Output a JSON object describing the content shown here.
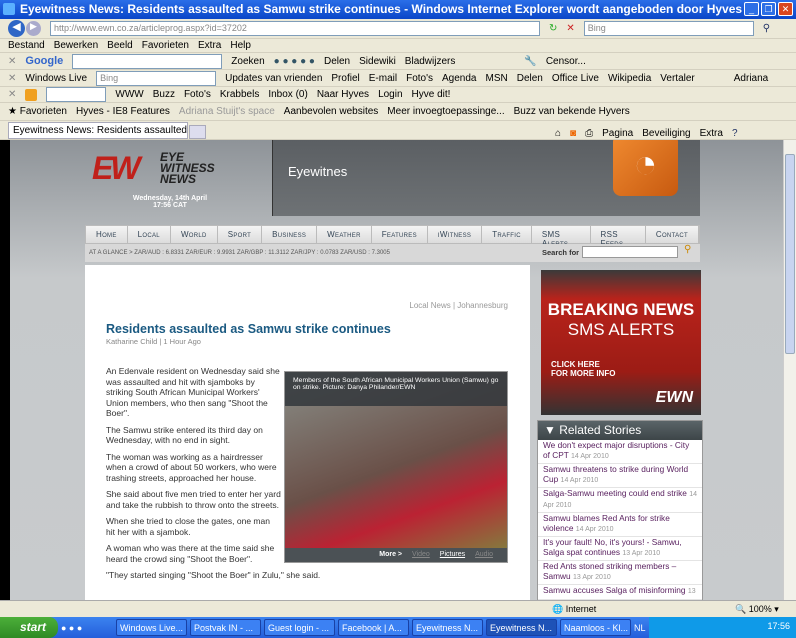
{
  "window": {
    "title": "Eyewitness News: Residents assaulted as Samwu strike continues - Windows Internet Explorer wordt aangeboden door Hyves"
  },
  "address": {
    "url": "http://www.ewn.co.za/articleprog.aspx?id=37202",
    "search_placeholder": "Bing"
  },
  "menu": [
    "Bestand",
    "Bewerken",
    "Beeld",
    "Favorieten",
    "Extra",
    "Help"
  ],
  "google_toolbar": {
    "logo": "Google",
    "search": "Zoeken",
    "share": "Delen",
    "sidewiki": "Sidewiki",
    "bookmarks": "Bladwijzers",
    "censor": "Censor..."
  },
  "live_toolbar": {
    "brand": "Windows Live",
    "search_placeholder": "Bing",
    "links": [
      "Updates van vrienden",
      "Profiel",
      "E-mail",
      "Foto's",
      "Agenda",
      "MSN",
      "Delen"
    ],
    "office": "Office Live",
    "wikipedia": "Wikipedia",
    "translate": "Vertaler",
    "user": "Adriana"
  },
  "hyves_toolbar": {
    "links": [
      "WWW",
      "Buzz",
      "Foto's",
      "Krabbels",
      "Inbox (0)",
      "Naar Hyves",
      "Login",
      "Hyve dit!"
    ]
  },
  "favorites_bar": {
    "label": "Favorieten",
    "items": [
      "Hyves - IE8 Features",
      "Adriana Stuijt's space",
      "Aanbevolen websites",
      "Meer invoegtoepassinge...",
      "Buzz van bekende Hyvers"
    ]
  },
  "tab": {
    "label": "Eyewitness News: Residents assaulted as Samwu stri..."
  },
  "command_bar": [
    "Pagina",
    "Beveiliging",
    "Extra"
  ],
  "site": {
    "logo": "EYE WITNESS NEWS",
    "date": "Wednesday, 14th April",
    "time": "17:56 CAT",
    "banner": "Eyewitnes",
    "nav": [
      "Home",
      "Local",
      "World",
      "Sport",
      "Business",
      "Weather",
      "Features",
      "iWitness",
      "Traffic",
      "SMS Alerts",
      "RSS Feeds",
      "Contact"
    ],
    "glance": "AT A GLANCE >  ZAR/AUD : 6.8331   ZAR/EUR : 9.9931   ZAR/GBP : 11.3112   ZAR/JPY : 0.0783   ZAR/USD : 7.3005",
    "search_label": "Search for"
  },
  "article": {
    "section": "Local News | Johannesburg",
    "title": "Residents assaulted as Samwu strike continues",
    "byline": "Katharine Child | 1 Hour Ago",
    "paragraphs": [
      "An Edenvale resident on Wednesday said she was assaulted and hit with sjamboks by striking South African Municipal Workers' Union members, who then sang \"Shoot the Boer\".",
      "The Samwu strike entered its third day on Wednesday, with no end in sight.",
      "The woman was working as a hairdresser when a crowd of about 50 workers, who were trashing streets, approached her house.",
      "She said about five men tried to enter her yard and take the rubbish to throw onto the streets.",
      "When she tried to close the gates, one man hit her with a sjambok.",
      "A woman who was there at the time said she heard the crowd sing \"Shoot the Boer\".",
      "\"They started singing \"Shoot the Boer\" in Zulu,\" she said."
    ],
    "caption": "Members of the South African Municipal Workers Union (Samwu) go on strike. Picture: Danya Philander/EWN",
    "media": {
      "more": "More >",
      "video": "Video",
      "pictures": "Pictures",
      "audio": "Audio"
    }
  },
  "ad": {
    "line1": "BREAKING NEWS",
    "line2": "SMS ALERTS",
    "cta1": "CLICK HERE",
    "cta2": "FOR MORE INFO",
    "logo": "EWN"
  },
  "related": {
    "title": "Related Stories",
    "items": [
      {
        "text": "We don't expect major disruptions - City of CPT",
        "date": "14 Apr 2010"
      },
      {
        "text": "Samwu threatens to strike during World Cup",
        "date": "14 Apr 2010"
      },
      {
        "text": "Salga-Samwu meeting could end strike",
        "date": "14 Apr 2010"
      },
      {
        "text": "Samwu blames Red Ants for strike violence",
        "date": "14 Apr 2010"
      },
      {
        "text": "It's your fault! No, it's yours! - Samwu, Salga spat continues",
        "date": "13 Apr 2010"
      },
      {
        "text": "Red Ants stoned striking members – Samwu",
        "date": "13 Apr 2010"
      },
      {
        "text": "Samwu accuses Salga of misinforming",
        "date": "13"
      }
    ]
  },
  "status": {
    "zone": "Internet",
    "zoom": "100%"
  },
  "taskbar": {
    "start": "start",
    "tasks": [
      "Windows Live...",
      "Postvak IN - ...",
      "Guest login - ...",
      "Facebook | A...",
      "Eyewitness N...",
      "Eyewitness N...",
      "Naamloos - Kl..."
    ],
    "lang": "NL",
    "clock": "17:56"
  }
}
